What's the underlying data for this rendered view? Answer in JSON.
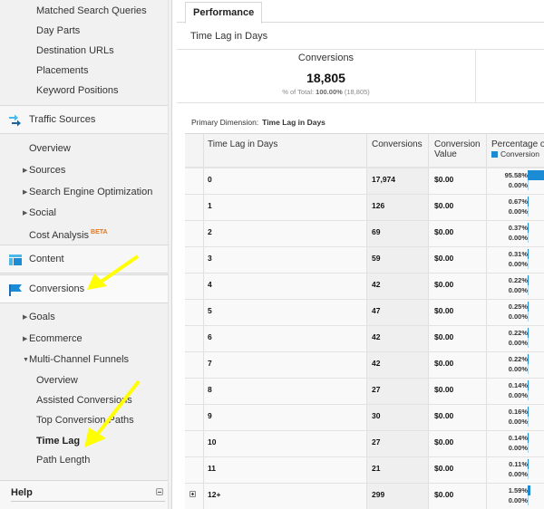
{
  "sidebar": {
    "top_items": [
      "Matched Search Queries",
      "Day Parts",
      "Destination URLs",
      "Placements",
      "Keyword Positions"
    ],
    "traffic_sources": {
      "label": "Traffic Sources",
      "items": [
        {
          "label": "Overview",
          "expandable": false
        },
        {
          "label": "Sources",
          "expandable": true
        },
        {
          "label": "Search Engine Optimization",
          "expandable": true
        },
        {
          "label": "Social",
          "expandable": true
        },
        {
          "label": "Cost Analysis",
          "expandable": false,
          "badge": "BETA"
        }
      ]
    },
    "content": {
      "label": "Content"
    },
    "conversions": {
      "label": "Conversions",
      "items": [
        {
          "label": "Goals",
          "expandable": true,
          "expanded": false
        },
        {
          "label": "Ecommerce",
          "expandable": true,
          "expanded": false
        },
        {
          "label": "Multi-Channel Funnels",
          "expandable": true,
          "expanded": true
        }
      ],
      "mcf_items": [
        {
          "label": "Overview",
          "active": false
        },
        {
          "label": "Assisted Conversions",
          "active": false
        },
        {
          "label": "Top Conversion Paths",
          "active": false
        },
        {
          "label": "Time Lag",
          "active": true
        },
        {
          "label": "Path Length",
          "active": false
        }
      ]
    },
    "help": {
      "label": "Help"
    }
  },
  "main": {
    "tab": "Performance",
    "subtitle": "Time Lag in Days",
    "scorecard": {
      "label": "Conversions",
      "value": "18,805",
      "sub_prefix": "% of Total:",
      "sub_pct": "100.00%",
      "sub_total": "(18,805)"
    },
    "primary_dimension": {
      "label": "Primary Dimension:",
      "value": "Time Lag in Days"
    },
    "table": {
      "headers": {
        "dimension": "Time Lag in Days",
        "conversions": "Conversions",
        "conversion_value_1": "Conversion",
        "conversion_value_2": "Value",
        "percentage": "Percentage o",
        "legend": "Conversion"
      },
      "rows": [
        {
          "lag": "0",
          "conversions": "17,974",
          "value": "$0.00",
          "pct_conv": "95.58%",
          "pct_value": "0.00%",
          "share": 95.58
        },
        {
          "lag": "1",
          "conversions": "126",
          "value": "$0.00",
          "pct_conv": "0.67%",
          "pct_value": "0.00%",
          "share": 0.67
        },
        {
          "lag": "2",
          "conversions": "69",
          "value": "$0.00",
          "pct_conv": "0.37%",
          "pct_value": "0.00%",
          "share": 0.37
        },
        {
          "lag": "3",
          "conversions": "59",
          "value": "$0.00",
          "pct_conv": "0.31%",
          "pct_value": "0.00%",
          "share": 0.31
        },
        {
          "lag": "4",
          "conversions": "42",
          "value": "$0.00",
          "pct_conv": "0.22%",
          "pct_value": "0.00%",
          "share": 0.22
        },
        {
          "lag": "5",
          "conversions": "47",
          "value": "$0.00",
          "pct_conv": "0.25%",
          "pct_value": "0.00%",
          "share": 0.25
        },
        {
          "lag": "6",
          "conversions": "42",
          "value": "$0.00",
          "pct_conv": "0.22%",
          "pct_value": "0.00%",
          "share": 0.22
        },
        {
          "lag": "7",
          "conversions": "42",
          "value": "$0.00",
          "pct_conv": "0.22%",
          "pct_value": "0.00%",
          "share": 0.22
        },
        {
          "lag": "8",
          "conversions": "27",
          "value": "$0.00",
          "pct_conv": "0.14%",
          "pct_value": "0.00%",
          "share": 0.14
        },
        {
          "lag": "9",
          "conversions": "30",
          "value": "$0.00",
          "pct_conv": "0.16%",
          "pct_value": "0.00%",
          "share": 0.16
        },
        {
          "lag": "10",
          "conversions": "27",
          "value": "$0.00",
          "pct_conv": "0.14%",
          "pct_value": "0.00%",
          "share": 0.14
        },
        {
          "lag": "11",
          "conversions": "21",
          "value": "$0.00",
          "pct_conv": "0.11%",
          "pct_value": "0.00%",
          "share": 0.11
        },
        {
          "lag": "12+",
          "conversions": "299",
          "value": "$0.00",
          "pct_conv": "1.59%",
          "pct_value": "0.00%",
          "share": 1.59,
          "expandable": true
        }
      ]
    }
  },
  "colors": {
    "accent": "#1a8bd4",
    "beta": "#e2771b",
    "annotation_arrow": "#ffff00"
  }
}
